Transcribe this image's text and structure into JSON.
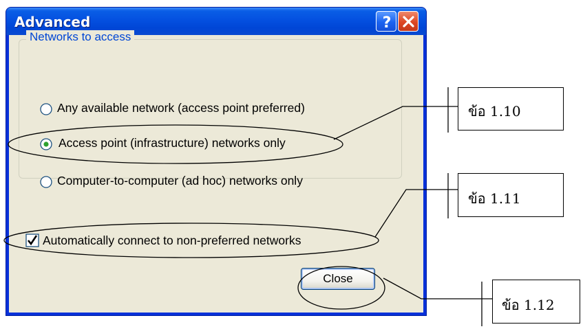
{
  "window": {
    "title": "Advanced",
    "help_label": "?",
    "close_label": "✕"
  },
  "group": {
    "label": "Networks to access",
    "options": [
      {
        "label": "Any available network (access point preferred)",
        "selected": false
      },
      {
        "label": "Access point (infrastructure) networks only",
        "selected": true
      },
      {
        "label": "Computer-to-computer (ad hoc) networks only",
        "selected": false
      }
    ]
  },
  "auto_connect": {
    "label": "Automatically connect to non-preferred networks",
    "checked": true
  },
  "close_button": {
    "label": "Close"
  },
  "annotations": [
    {
      "label": "ข้อ 1.10",
      "target": "option-1"
    },
    {
      "label": "ข้อ 1.11",
      "target": "auto-connect-checkbox"
    },
    {
      "label": "ข้อ 1.12",
      "target": "close-button"
    }
  ],
  "colors": {
    "titlebar": "#0450e0",
    "dialog_bg": "#ece9d8",
    "group_label": "#0046d5",
    "radio_dot": "#2ea12e"
  }
}
